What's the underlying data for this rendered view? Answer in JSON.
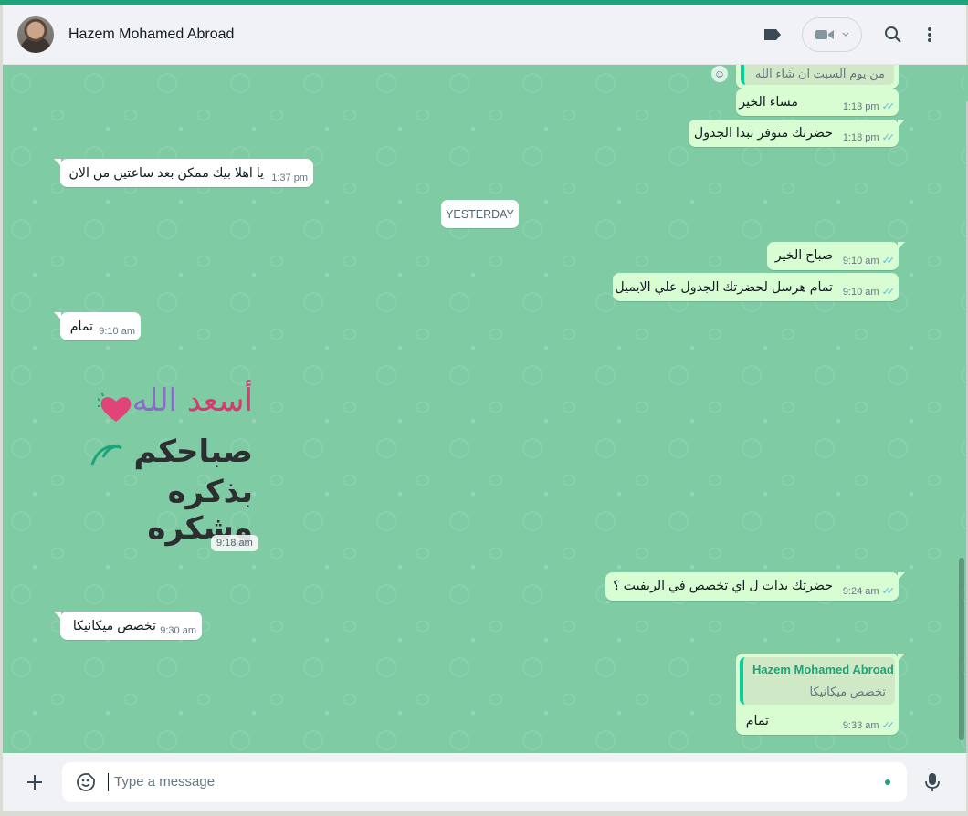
{
  "contact": {
    "name": "Hazem Mohamed Abroad"
  },
  "header_icons": {
    "label": "label-icon",
    "video": "video-camera-icon",
    "search": "search-icon",
    "menu": "menu-dots-icon"
  },
  "date_divider": "YESTERDAY",
  "messages": {
    "m0": {
      "direction": "out",
      "text": "من يوم السبت ان شاء الله",
      "time": ""
    },
    "m1": {
      "direction": "out",
      "text": "مساء الخير",
      "time": "1:13 pm",
      "status": "read"
    },
    "m2": {
      "direction": "out",
      "text": "حضرتك متوفر نبدا الجدول",
      "time": "1:18 pm",
      "status": "read"
    },
    "m3": {
      "direction": "in",
      "text": "يا اهلا بيك ممكن بعد ساعتين من الان",
      "time": "1:37 pm"
    },
    "m4": {
      "direction": "out",
      "text": "صباح الخير",
      "time": "9:10 am",
      "status": "read"
    },
    "m5": {
      "direction": "out",
      "text": "تمام هرسل لحضرتك الجدول علي الايميل",
      "time": "9:10 am",
      "status": "read"
    },
    "m6": {
      "direction": "in",
      "text": "تمام",
      "time": "9:10 am"
    },
    "m7": {
      "direction": "in",
      "type": "sticker",
      "time": "9:18 am"
    },
    "m8": {
      "direction": "out",
      "text": "حضرتك بدات ل اي تخصص في الريفيت ؟",
      "time": "9:24 am",
      "status": "read"
    },
    "m9": {
      "direction": "in",
      "text": "تخصص ميكانيكا",
      "time": "9:30 am"
    },
    "m10": {
      "direction": "out",
      "text": "تمام",
      "time": "9:33 am",
      "status": "read",
      "quote": {
        "name": "Hazem Mohamed Abroad",
        "text": "تخصص ميكانيكا"
      }
    }
  },
  "sticker": {
    "line1_part1": "أسعد",
    "line1_part2": "الله",
    "line2": "صباحكم",
    "line3": "بذكره وشكره"
  },
  "composer": {
    "placeholder": "Type a message"
  },
  "colors": {
    "accent": "#1fa37a",
    "chat_bg": "#7ecba4",
    "outgoing": "#d9fdd3",
    "incoming": "#ffffff",
    "read_ticks": "#53bdeb"
  }
}
